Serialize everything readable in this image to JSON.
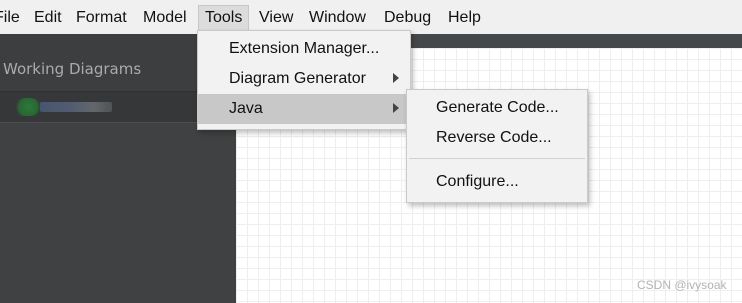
{
  "menubar": {
    "items": [
      {
        "label": "File"
      },
      {
        "label": "Edit"
      },
      {
        "label": "Format"
      },
      {
        "label": "Model"
      },
      {
        "label": "Tools"
      },
      {
        "label": "View"
      },
      {
        "label": "Window"
      },
      {
        "label": "Debug"
      },
      {
        "label": "Help"
      }
    ]
  },
  "sidebar": {
    "title": "Working Diagrams"
  },
  "tools_menu": {
    "items": [
      {
        "label": "Extension Manager...",
        "has_submenu": false
      },
      {
        "label": "Diagram Generator",
        "has_submenu": true
      },
      {
        "label": "Java",
        "has_submenu": true,
        "highlighted": true
      }
    ]
  },
  "java_submenu": {
    "items": [
      {
        "label": "Generate Code..."
      },
      {
        "label": "Reverse Code..."
      },
      {
        "label": "Configure..."
      }
    ]
  },
  "watermark": "CSDN @ivysoak",
  "colors": {
    "sidebar_bg": "#3f4142",
    "menu_highlight": "#c8c8c8",
    "menubar_bg": "#f0f0f0"
  }
}
